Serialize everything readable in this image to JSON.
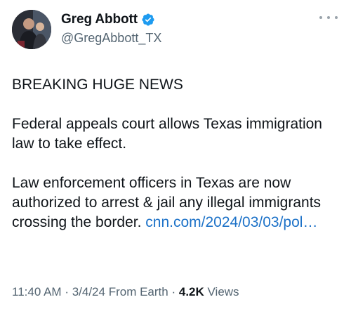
{
  "author": {
    "display_name": "Greg Abbott",
    "handle": "@GregAbbott_TX",
    "verified": true
  },
  "tweet": {
    "headline": "BREAKING HUGE NEWS",
    "paragraph_2": "Federal appeals court allows Texas immigration law to take effect.",
    "paragraph_3": "Law enforcement officers in Texas are now authorized to arrest & jail any illegal immigrants crossing the border.",
    "link_text": "cnn.com/2024/03/03/pol…"
  },
  "meta": {
    "time": "11:40 AM",
    "date": "3/4/24",
    "location": "From Earth",
    "views_count": "4.2K",
    "views_label": "Views"
  },
  "colors": {
    "link": "#1d72c8",
    "verified": "#1d9bf0",
    "secondary_text": "#536471"
  },
  "icons": {
    "verified": "verified-badge-icon",
    "more": "more-options-icon"
  }
}
